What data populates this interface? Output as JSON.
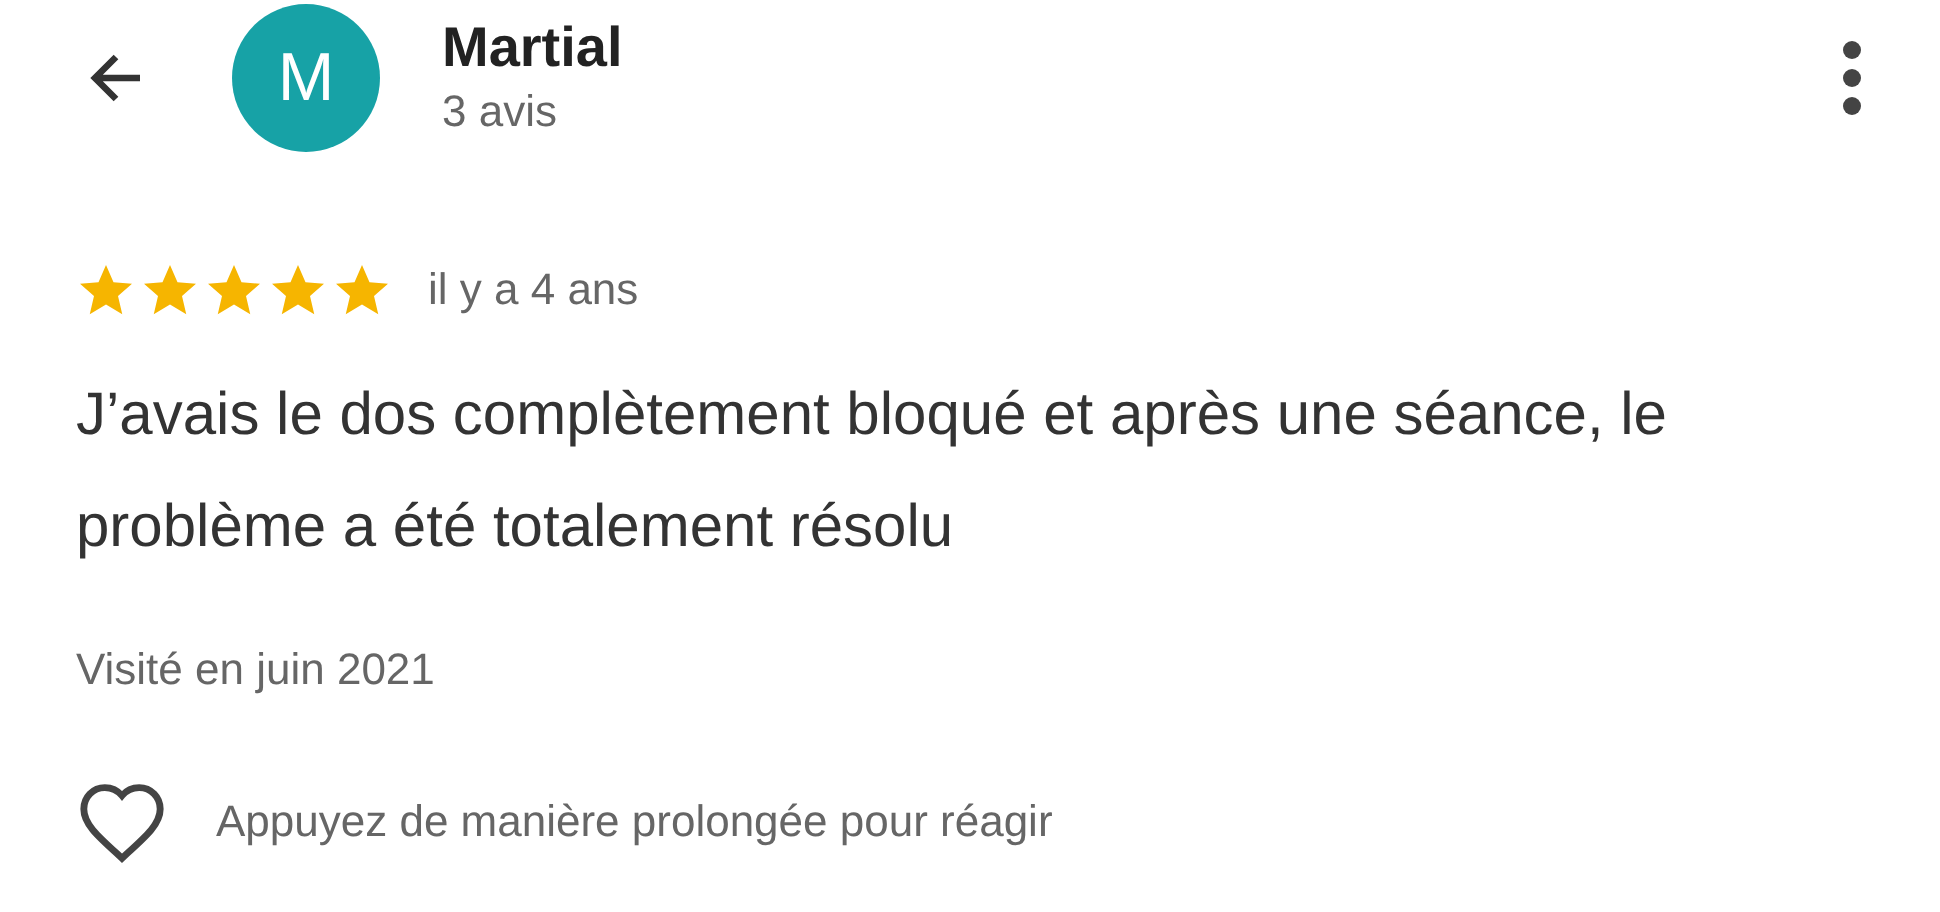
{
  "header": {
    "avatar_letter": "M",
    "name": "Martial",
    "subtitle": "3 avis"
  },
  "review": {
    "stars": 5,
    "time": "il y a 4 ans",
    "text": "J’avais le dos complètement bloqué et après une séance, le problème a été totalement résolu",
    "visited": "Visité en juin 2021"
  },
  "reaction": {
    "hint": "Appuyez de manière prolongée pour réagir"
  }
}
